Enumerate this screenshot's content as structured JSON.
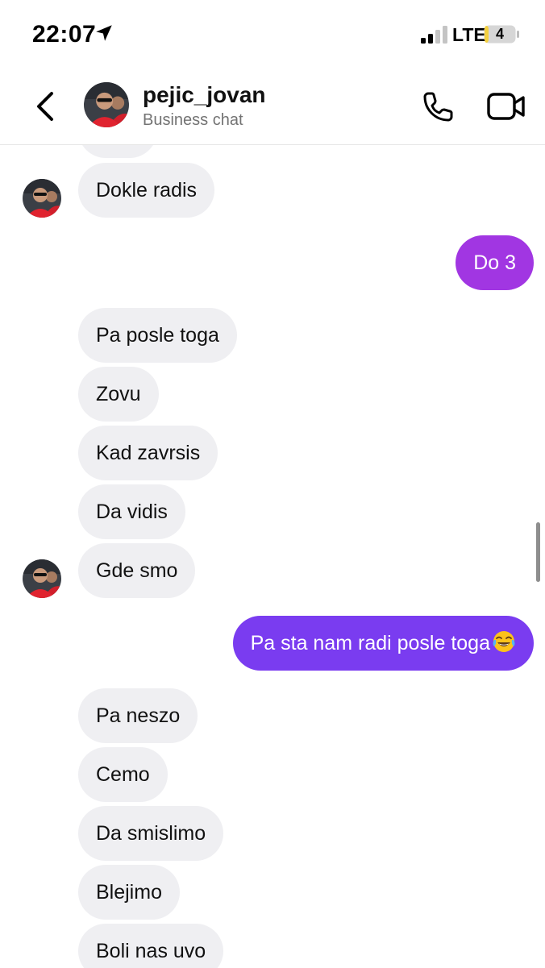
{
  "status_bar": {
    "time": "22:07",
    "network": "LTE",
    "battery_level": "4",
    "icons": [
      "location-arrow-icon",
      "signal-bars-icon",
      "battery-icon"
    ]
  },
  "header": {
    "name": "pejic_jovan",
    "subtitle": "Business chat",
    "icons": [
      "back-chevron-icon",
      "phone-icon",
      "video-camera-icon"
    ]
  },
  "messages": [
    {
      "side": "in",
      "text": "Dokle radis"
    },
    {
      "side": "out",
      "text": "Do 3"
    },
    {
      "side": "in",
      "text": "Pa posle toga"
    },
    {
      "side": "in",
      "text": "Zovu"
    },
    {
      "side": "in",
      "text": "Kad zavrsis"
    },
    {
      "side": "in",
      "text": "Da vidis"
    },
    {
      "side": "in",
      "text": "Gde smo"
    },
    {
      "side": "out",
      "text": "Pa sta nam radi posle toga",
      "emoji": "face-with-tears-of-joy-icon"
    },
    {
      "side": "in",
      "text": "Pa neszo"
    },
    {
      "side": "in",
      "text": "Cemo"
    },
    {
      "side": "in",
      "text": "Da smislimo"
    },
    {
      "side": "in",
      "text": "Blejimo"
    },
    {
      "side": "in",
      "text": "Boli nas uvo"
    }
  ],
  "colors": {
    "incoming_bubble": "#efeff2",
    "outgoing_bubble_1": "#a136e2",
    "outgoing_bubble_2": "#7a3cf0"
  }
}
